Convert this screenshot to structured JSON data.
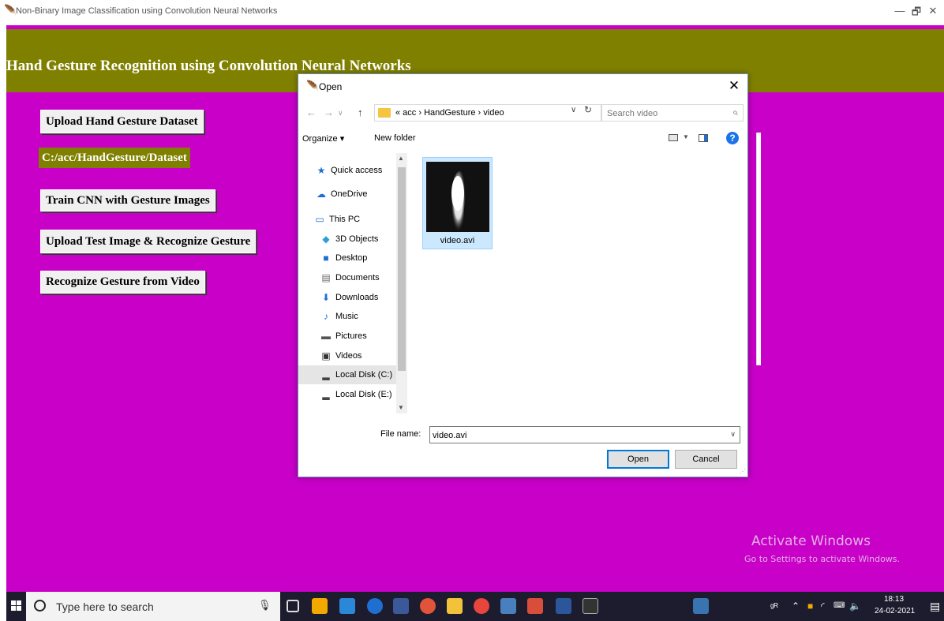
{
  "window": {
    "title": "Non-Binary Image Classification using Convolution Neural Networks",
    "minimize": "—",
    "restore": "🗗",
    "close": "✕"
  },
  "app": {
    "heading": "Hand Gesture Recognition using Convolution Neural Networks",
    "upload_dataset_label": "Upload Hand Gesture Dataset",
    "dataset_path": "C:/acc/HandGesture/Dataset",
    "train_cnn_label": "Train CNN with Gesture Images",
    "upload_test_label": "Upload Test Image & Recognize Gesture",
    "recognize_video_label": "Recognize Gesture from Video",
    "colors": {
      "background": "#c800c8",
      "header": "#808000",
      "path_label": "#808000"
    }
  },
  "dialog": {
    "title": "Open",
    "breadcrumb": "« acc › HandGesture › video",
    "search_placeholder": "Search video",
    "organize_label": "Organize ▾",
    "new_folder_label": "New folder",
    "nav_items": [
      {
        "label": "Quick access",
        "icon": "star-icon"
      },
      {
        "label": "OneDrive",
        "icon": "cloud-icon"
      },
      {
        "label": "This PC",
        "icon": "monitor-icon"
      },
      {
        "label": "3D Objects",
        "icon": "cube-icon"
      },
      {
        "label": "Desktop",
        "icon": "desktop-icon"
      },
      {
        "label": "Documents",
        "icon": "document-icon"
      },
      {
        "label": "Downloads",
        "icon": "download-arrow-icon"
      },
      {
        "label": "Music",
        "icon": "music-note-icon"
      },
      {
        "label": "Pictures",
        "icon": "picture-icon"
      },
      {
        "label": "Videos",
        "icon": "film-icon"
      },
      {
        "label": "Local Disk (C:)",
        "icon": "drive-icon"
      },
      {
        "label": "Local Disk (E:)",
        "icon": "drive-icon"
      }
    ],
    "selected_nav": "Local Disk (C:)",
    "files": [
      {
        "name": "video.avi"
      }
    ],
    "file_name_label": "File name:",
    "file_name_value": "video.avi",
    "open_label": "Open",
    "cancel_label": "Cancel"
  },
  "watermark": {
    "line1": "Activate Windows",
    "line2": "Go to Settings to activate Windows."
  },
  "taskbar": {
    "search_placeholder": "Type here to search",
    "time": "18:13",
    "date": "24-02-2021"
  }
}
